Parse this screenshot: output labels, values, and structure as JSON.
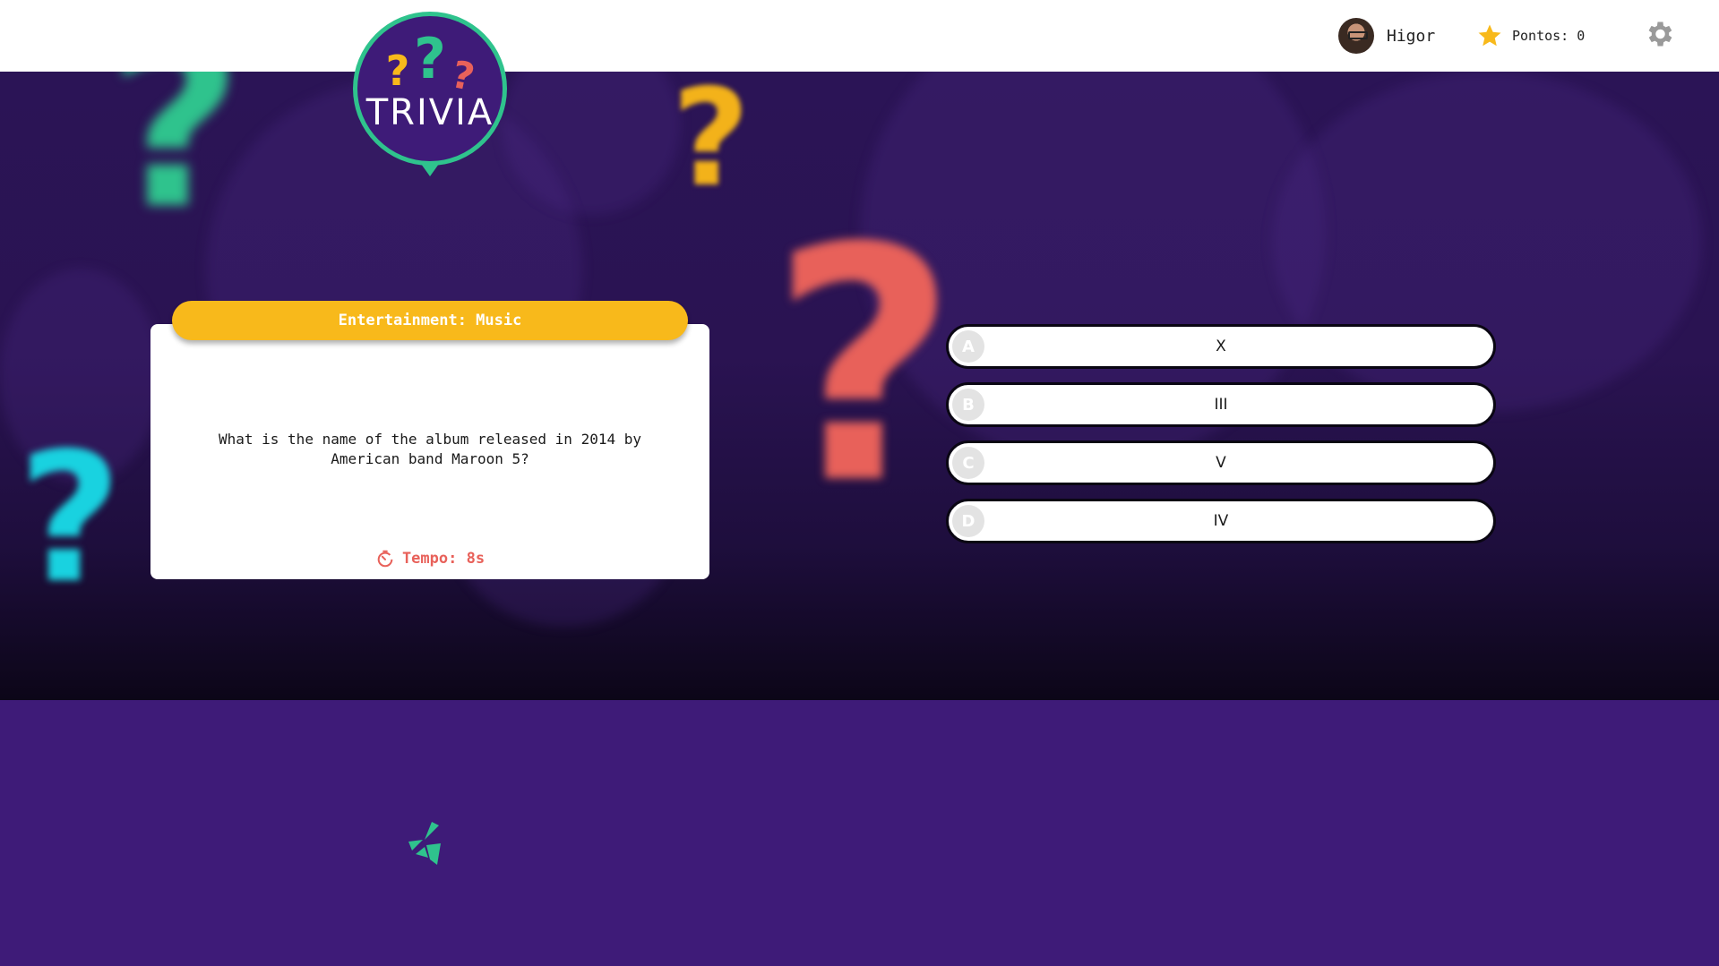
{
  "header": {
    "user": {
      "name": "Higor",
      "avatar_icon": "user-avatar"
    },
    "points": {
      "label": "Pontos: 0",
      "icon": "star-icon"
    },
    "settings": {
      "icon": "gear-icon"
    }
  },
  "logo": {
    "text": "TRIVIA",
    "icon": "question-marks-logo"
  },
  "question_card": {
    "category": "Entertainment: Music",
    "question": "What is the name of the album released in 2014 by American band Maroon 5?",
    "timer_label": "Tempo: 8s"
  },
  "answers": [
    {
      "letter": "A",
      "text": "X"
    },
    {
      "letter": "B",
      "text": "III"
    },
    {
      "letter": "C",
      "text": "V"
    },
    {
      "letter": "D",
      "text": "IV"
    }
  ],
  "colors": {
    "header_bg": "#ffffff",
    "footer_bg": "#3e1b78",
    "category_pill": "#f8b91b",
    "timer": "#e8615a",
    "accent_green": "#2fc38d"
  }
}
